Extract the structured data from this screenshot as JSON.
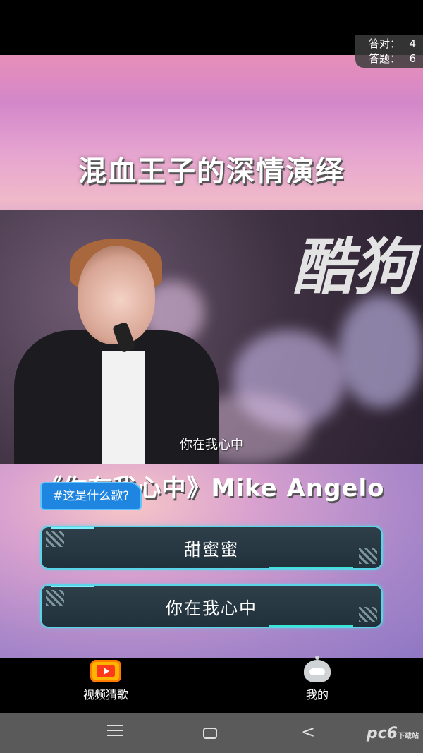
{
  "score": {
    "correct_label": "答对：",
    "correct_value": "4",
    "answered_label": "答题：",
    "answered_value": "6"
  },
  "video": {
    "title_caption": "混血王子的深情演绎",
    "stage_logo_text": "酷狗",
    "subtitle": "你在我心中",
    "song_info_caption": "《你在我心中》Mike Angelo"
  },
  "question": {
    "tag": "#这是什么歌?"
  },
  "answers": [
    {
      "label": "甜蜜蜜"
    },
    {
      "label": "你在我心中"
    }
  ],
  "tabs": [
    {
      "label": "视频猜歌",
      "icon": "video-play-icon"
    },
    {
      "label": "我的",
      "icon": "profile-icon"
    }
  ],
  "nav": {
    "back_glyph": "<"
  },
  "watermark": {
    "text": "pc6",
    "sub": "下载站"
  }
}
